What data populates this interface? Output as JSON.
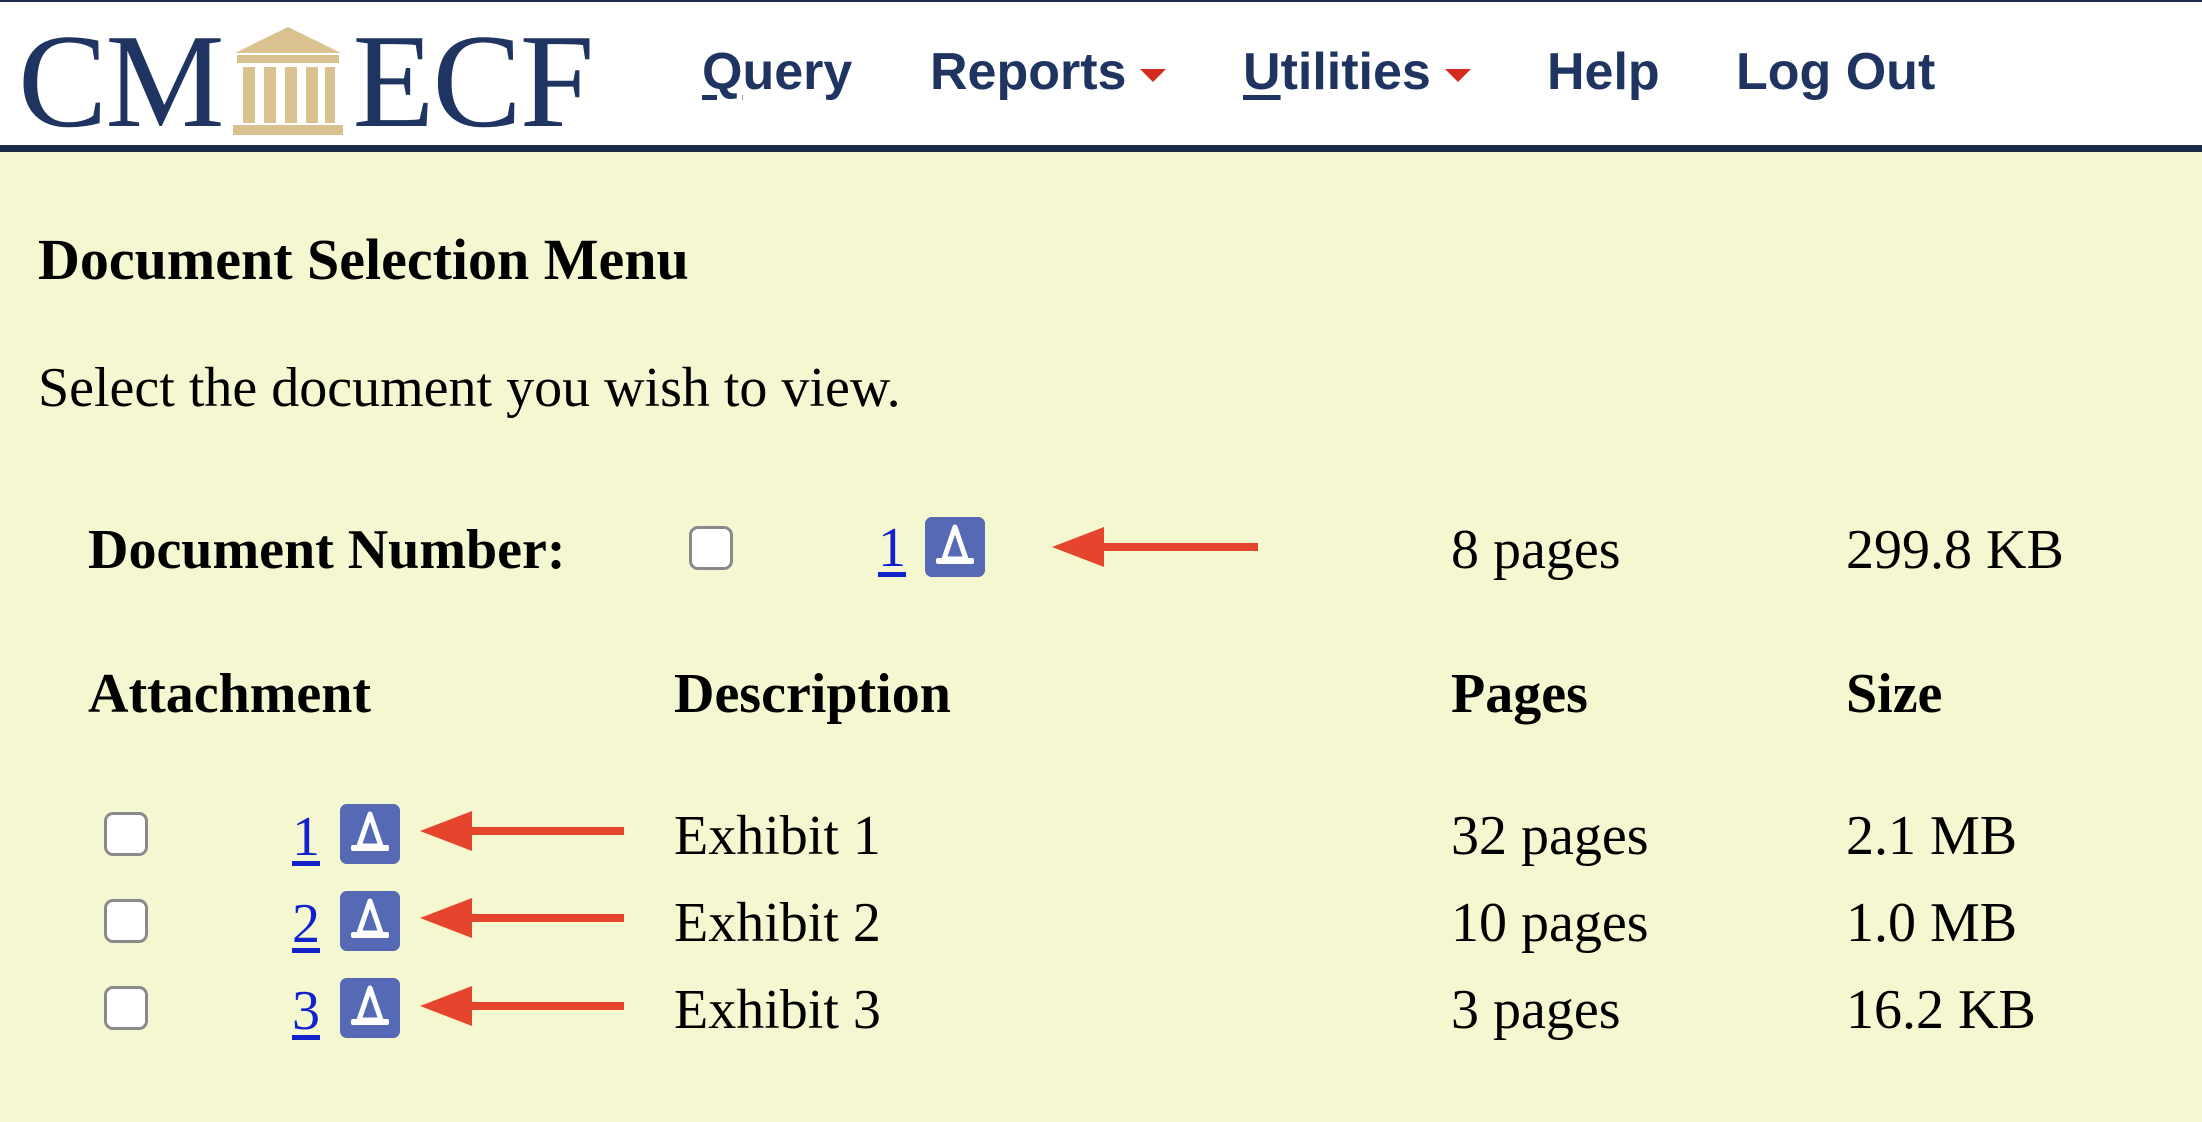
{
  "logo": {
    "left": "CM",
    "right": "ECF"
  },
  "nav": {
    "query_prefix": "Q",
    "query_rest": "uery",
    "reports": "Reports",
    "utilities_prefix": "U",
    "utilities_rest": "tilities",
    "help": "Help",
    "logout": "Log Out"
  },
  "page": {
    "title": "Document Selection Menu",
    "subtitle": "Select the document you wish to view."
  },
  "document": {
    "label": "Document Number:",
    "number": "1",
    "pages": "8 pages",
    "size": "299.8 KB"
  },
  "table": {
    "headers": {
      "attachment": "Attachment",
      "description": "Description",
      "pages": "Pages",
      "size": "Size"
    },
    "rows": [
      {
        "number": "1",
        "description": "Exhibit 1",
        "pages": "32 pages",
        "size": "2.1 MB"
      },
      {
        "number": "2",
        "description": "Exhibit 2",
        "pages": "10 pages",
        "size": "1.0 MB"
      },
      {
        "number": "3",
        "description": "Exhibit 3",
        "pages": "3 pages",
        "size": "16.2 KB"
      }
    ]
  },
  "colors": {
    "background": "#f5f7d1",
    "header_navy": "#1f3461",
    "link_blue": "#1122cc",
    "icon_blue": "#5569b5",
    "arrow_red": "#e5452c",
    "caret_red": "#d42b1e"
  },
  "icons": {
    "doc_icon": "pdf-viewer-icon",
    "annotation": "red-arrow-icon"
  }
}
